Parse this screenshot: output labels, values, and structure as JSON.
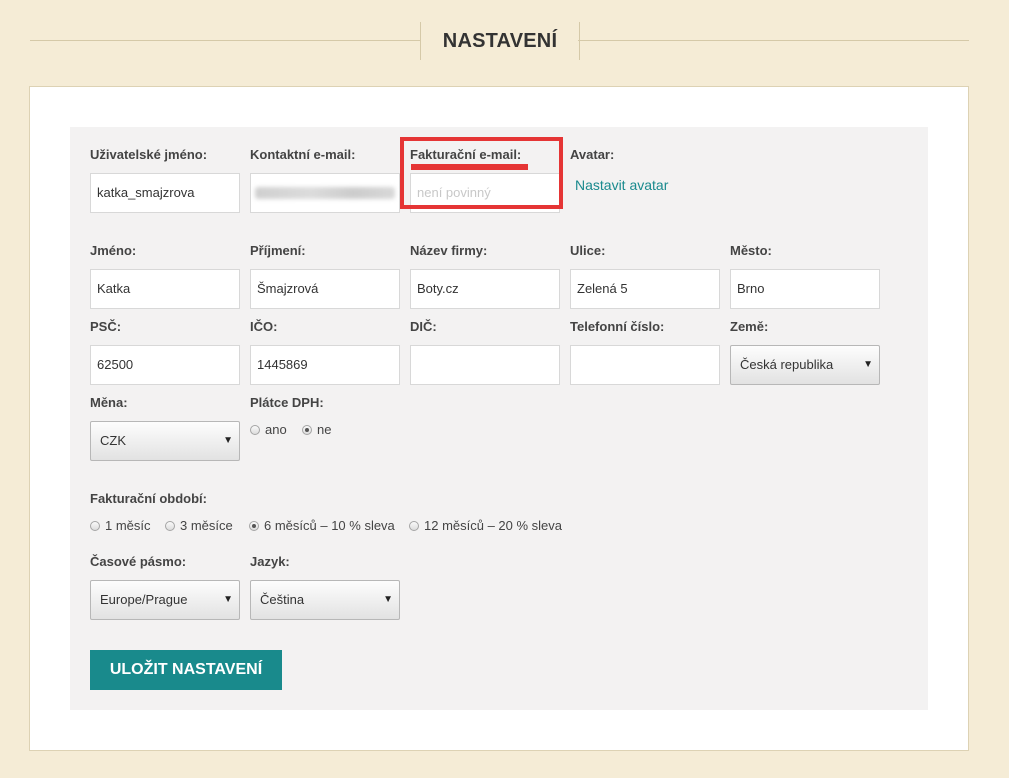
{
  "header": {
    "title": "NASTAVENÍ"
  },
  "account": {
    "username_label": "Uživatelské jméno:",
    "username_value": "katka_smajzrova",
    "contact_email_label": "Kontaktní e-mail:",
    "billing_email_label": "Fakturační e-mail:",
    "billing_email_placeholder": "není povinný",
    "avatar_label": "Avatar:",
    "avatar_link": "Nastavit avatar"
  },
  "address": {
    "first_name_label": "Jméno:",
    "first_name_value": "Katka",
    "last_name_label": "Příjmení:",
    "last_name_value": "Šmajzrová",
    "company_label": "Název firmy:",
    "company_value": "Boty.cz",
    "street_label": "Ulice:",
    "street_value": "Zelená 5",
    "city_label": "Město:",
    "city_value": "Brno",
    "zip_label": "PSČ:",
    "zip_value": "62500",
    "ico_label": "IČO:",
    "ico_value": "1445869",
    "dic_label": "DIČ:",
    "dic_value": "",
    "phone_label": "Telefonní číslo:",
    "phone_value": "",
    "country_label": "Země:",
    "country_value": "Česká republika"
  },
  "billing": {
    "currency_label": "Měna:",
    "currency_value": "CZK",
    "vat_label": "Plátce DPH:",
    "vat_options": [
      "ano",
      "ne"
    ],
    "vat_selected": "ne",
    "period_label": "Fakturační období:",
    "period_options": [
      "1 měsíc",
      "3 měsíce",
      "6 měsíců – 10 % sleva",
      "12 měsíců – 20 % sleva"
    ],
    "period_selected": "6 měsíců – 10 % sleva"
  },
  "locale": {
    "timezone_label": "Časové pásmo:",
    "timezone_value": "Europe/Prague",
    "language_label": "Jazyk:",
    "language_value": "Čeština"
  },
  "actions": {
    "save_label": "ULOŽIT NASTAVENÍ"
  },
  "colors": {
    "accent": "#198a8c",
    "highlight": "#e53535",
    "page_bg": "#f5ecd6"
  }
}
